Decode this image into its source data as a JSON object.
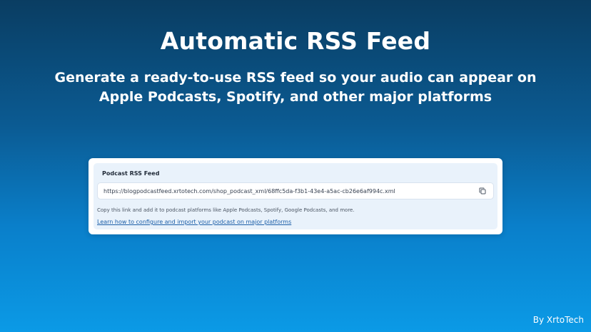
{
  "hero": {
    "title": "Automatic RSS Feed",
    "subtitle_line1": "Generate a ready-to-use RSS feed so your audio can appear on",
    "subtitle_line2": "Apple Podcasts, Spotify, and other major platforms"
  },
  "card": {
    "label": "Podcast RSS Feed",
    "feed_url": "https://blogpodcastfeed.xrtotech.com/shop_podcast_xml/68ffc5da-f3b1-43e4-a5ac-cb26e6af994c.xml",
    "copy_icon": "copy-icon",
    "help_text": "Copy this link and add it to podcast platforms like Apple Podcasts, Spotify, Google Podcasts, and more.",
    "learn_link": "Learn how to configure and import your podcast on major platforms"
  },
  "footer": {
    "credit": "By XrtoTech"
  },
  "colors": {
    "background_top": "#0a3d62",
    "background_bottom": "#0b9ae6",
    "card_bg": "#ffffff",
    "card_inner_bg": "#e9f2fb",
    "link": "#1d5fa8"
  }
}
